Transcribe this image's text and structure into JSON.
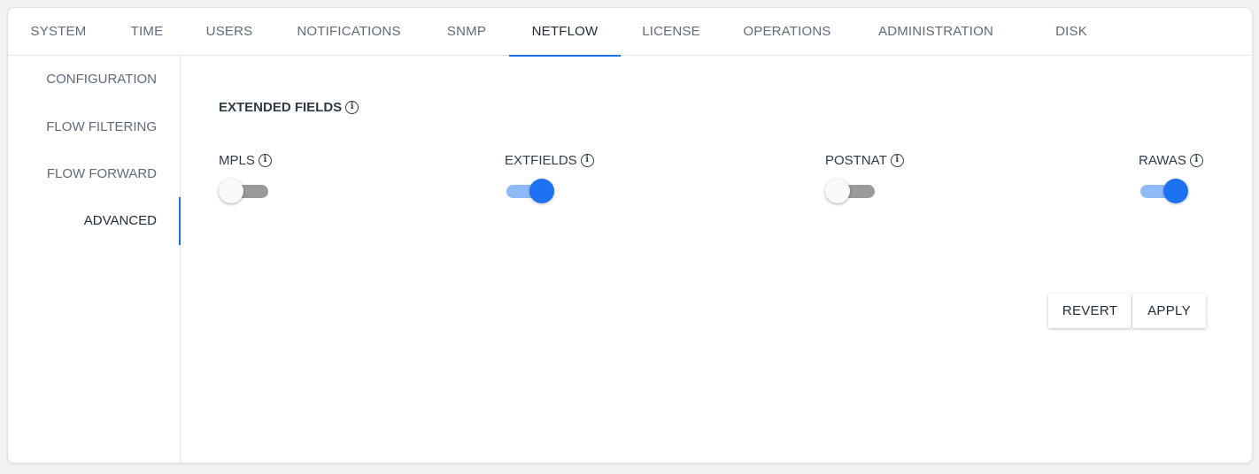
{
  "tabs": [
    {
      "label": "SYSTEM"
    },
    {
      "label": "TIME"
    },
    {
      "label": "USERS"
    },
    {
      "label": "NOTIFICATIONS"
    },
    {
      "label": "SNMP"
    },
    {
      "label": "NETFLOW",
      "active": true
    },
    {
      "label": "LICENSE"
    },
    {
      "label": "OPERATIONS"
    },
    {
      "label": "ADMINISTRATION"
    },
    {
      "label": "DISK"
    }
  ],
  "sidebar": {
    "items": [
      {
        "label": "CONFIGURATION"
      },
      {
        "label": "FLOW FILTERING"
      },
      {
        "label": "FLOW FORWARD"
      },
      {
        "label": "ADVANCED",
        "active": true
      }
    ]
  },
  "section": {
    "title": "EXTENDED FIELDS",
    "info_icon": "info-icon"
  },
  "fields": [
    {
      "label": "MPLS",
      "enabled": false
    },
    {
      "label": "EXTFIELDS",
      "enabled": true
    },
    {
      "label": "POSTNAT",
      "enabled": false
    },
    {
      "label": "RAWAS",
      "enabled": true
    }
  ],
  "actions": {
    "revert_label": "REVERT",
    "apply_label": "APPLY"
  },
  "colors": {
    "accent": "#1d6fe8",
    "toggle_on_thumb": "#1d72f2",
    "toggle_on_track": "#8fb9f7",
    "toggle_off_track": "#9a9a9a"
  }
}
